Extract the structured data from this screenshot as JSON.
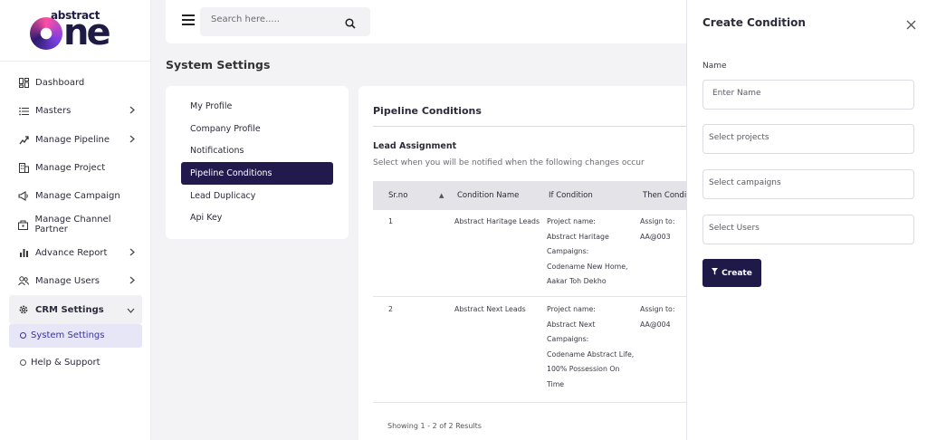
{
  "brand": {
    "small": "abstract",
    "big": "ne"
  },
  "sidebar": {
    "items": [
      {
        "label": "Dashboard",
        "icon": "dashboard-icon",
        "chevron": false
      },
      {
        "label": "Masters",
        "icon": "list-icon",
        "chevron": true
      },
      {
        "label": "Manage Pipeline",
        "icon": "pipeline-icon",
        "chevron": true
      },
      {
        "label": "Manage Project",
        "icon": "building-icon",
        "chevron": false
      },
      {
        "label": "Manage Campaign",
        "icon": "megaphone-icon",
        "chevron": false
      },
      {
        "label": "Manage Channel Partner",
        "icon": "partner-icon",
        "chevron": false
      },
      {
        "label": "Advance Report",
        "icon": "bar-chart-icon",
        "chevron": true
      },
      {
        "label": "Manage Users",
        "icon": "users-icon",
        "chevron": true
      },
      {
        "label": "CRM Settings",
        "icon": "gear-icon",
        "chevron": true
      }
    ],
    "sub_items": [
      {
        "label": "System Settings",
        "selected": true
      },
      {
        "label": "Help & Support",
        "selected": false
      }
    ]
  },
  "topbar": {
    "search_placeholder": "Search here....."
  },
  "page_title": "System Settings",
  "settings_menu": [
    {
      "label": "My Profile",
      "active": false
    },
    {
      "label": "Company Profile",
      "active": false
    },
    {
      "label": "Notifications",
      "active": false
    },
    {
      "label": "Pipeline Conditions",
      "active": true
    },
    {
      "label": "Lead Duplicacy",
      "active": false
    },
    {
      "label": "Api Key",
      "active": false
    }
  ],
  "main": {
    "title": "Pipeline Conditions",
    "section_title": "Lead Assignment",
    "section_sub": "Select when you will be notified when the following changes occur",
    "columns": [
      "Sr.no",
      "Condition Name",
      "If Condition",
      "Then Condit"
    ],
    "rows": [
      {
        "sr": "1",
        "name": "Abstract Haritage Leads",
        "if_lines": [
          "Project name:",
          "Abstract Haritage",
          "Campaigns:",
          "Codename New Home,",
          "Aakar Toh Dekho"
        ],
        "then_lines": [
          "Assign to:",
          "AA@003"
        ]
      },
      {
        "sr": "2",
        "name": "Abstract Next Leads",
        "if_lines": [
          "Project name:",
          "Abstract Next",
          "Campaigns:",
          "Codename Abstract Life,",
          "100% Possession On",
          "Time"
        ],
        "then_lines": [
          "Assign to:",
          "AA@004"
        ]
      }
    ],
    "footer": "Showing 1 - 2 of 2 Results"
  },
  "panel": {
    "title": "Create Condition",
    "name_label": "Name",
    "name_placeholder": "Enter Name",
    "projects_placeholder": "Select projects",
    "campaigns_placeholder": "Select campaigns",
    "users_placeholder": "Select Users",
    "create_label": "Create"
  },
  "colors": {
    "primary": "#1f1947",
    "selected_bg": "#e7e6f7",
    "selected_text": "#3a3399"
  }
}
